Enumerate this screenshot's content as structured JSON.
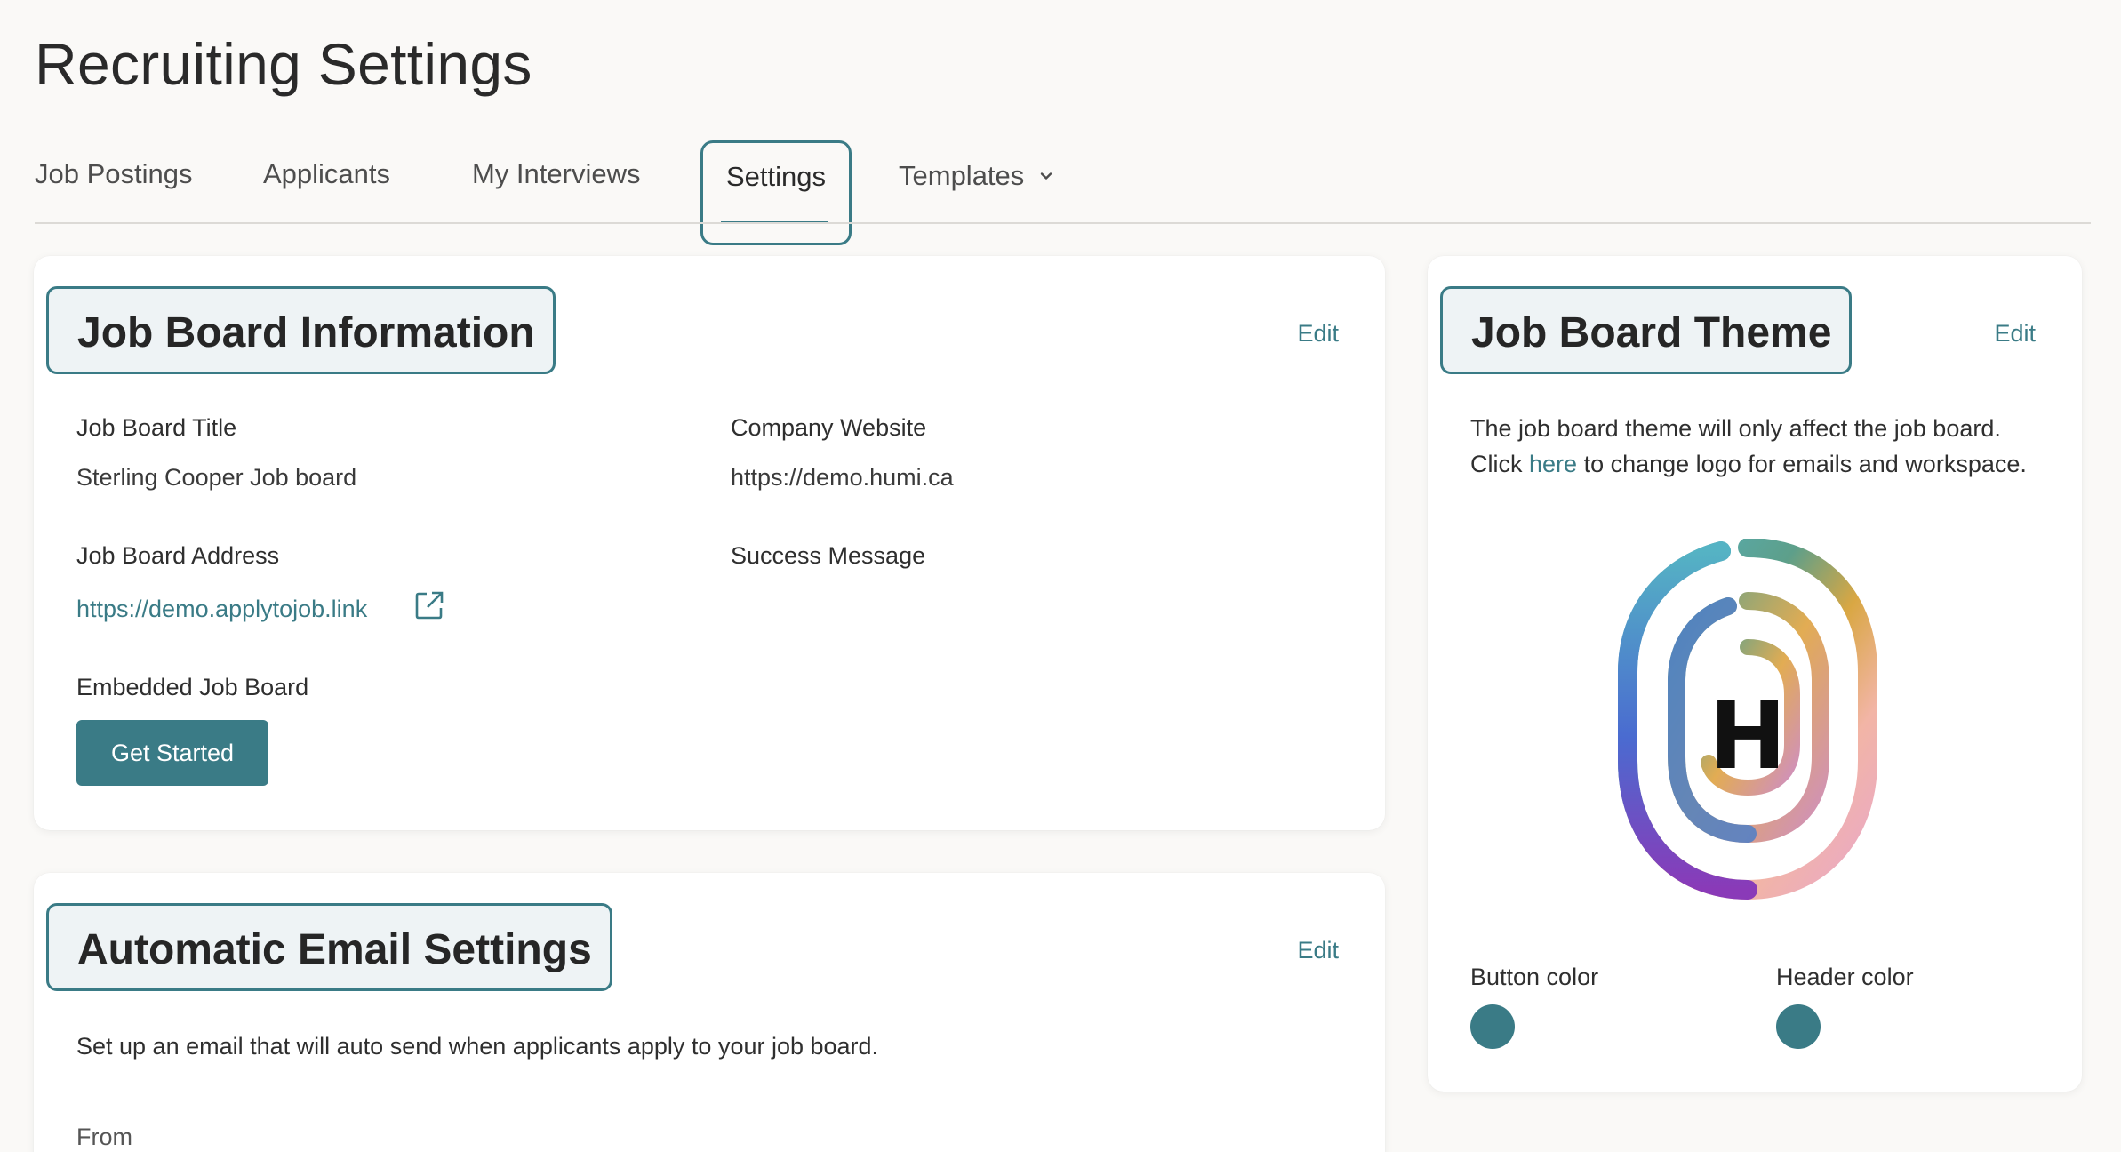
{
  "page_title": "Recruiting Settings",
  "tabs": [
    {
      "label": "Job Postings",
      "active": false
    },
    {
      "label": "Applicants",
      "active": false
    },
    {
      "label": "My Interviews",
      "active": false
    },
    {
      "label": "Settings",
      "active": true
    },
    {
      "label": "Templates",
      "active": false,
      "icon": "chevron-down-icon"
    }
  ],
  "job_board_info": {
    "heading": "Job Board Information",
    "edit_label": "Edit",
    "fields": {
      "title_label": "Job Board Title",
      "title_value": "Sterling Cooper Job board",
      "website_label": "Company Website",
      "website_value": "https://demo.humi.ca",
      "address_label": "Job Board Address",
      "address_value": "https://demo.applytojob.link",
      "address_icon": "external-link-icon",
      "success_label": "Success Message",
      "embedded_label": "Embedded Job Board"
    },
    "get_started_label": "Get Started"
  },
  "email_settings": {
    "heading": "Automatic Email Settings",
    "edit_label": "Edit",
    "description": "Set up an email that will auto send when applicants apply to your job board.",
    "from_label": "From"
  },
  "job_board_theme": {
    "heading": "Job Board Theme",
    "edit_label": "Edit",
    "description_line1": "The job board theme will only affect the job board.",
    "description_click": "Click",
    "description_here": "here",
    "description_rest": "to change logo for emails and workspace.",
    "logo_letter": "H",
    "button_color_label": "Button color",
    "header_color_label": "Header color",
    "button_color": "#3a7b86",
    "header_color": "#3a7b86"
  },
  "colors": {
    "accent": "#3a7b86",
    "page_background": "#faf9f7"
  }
}
